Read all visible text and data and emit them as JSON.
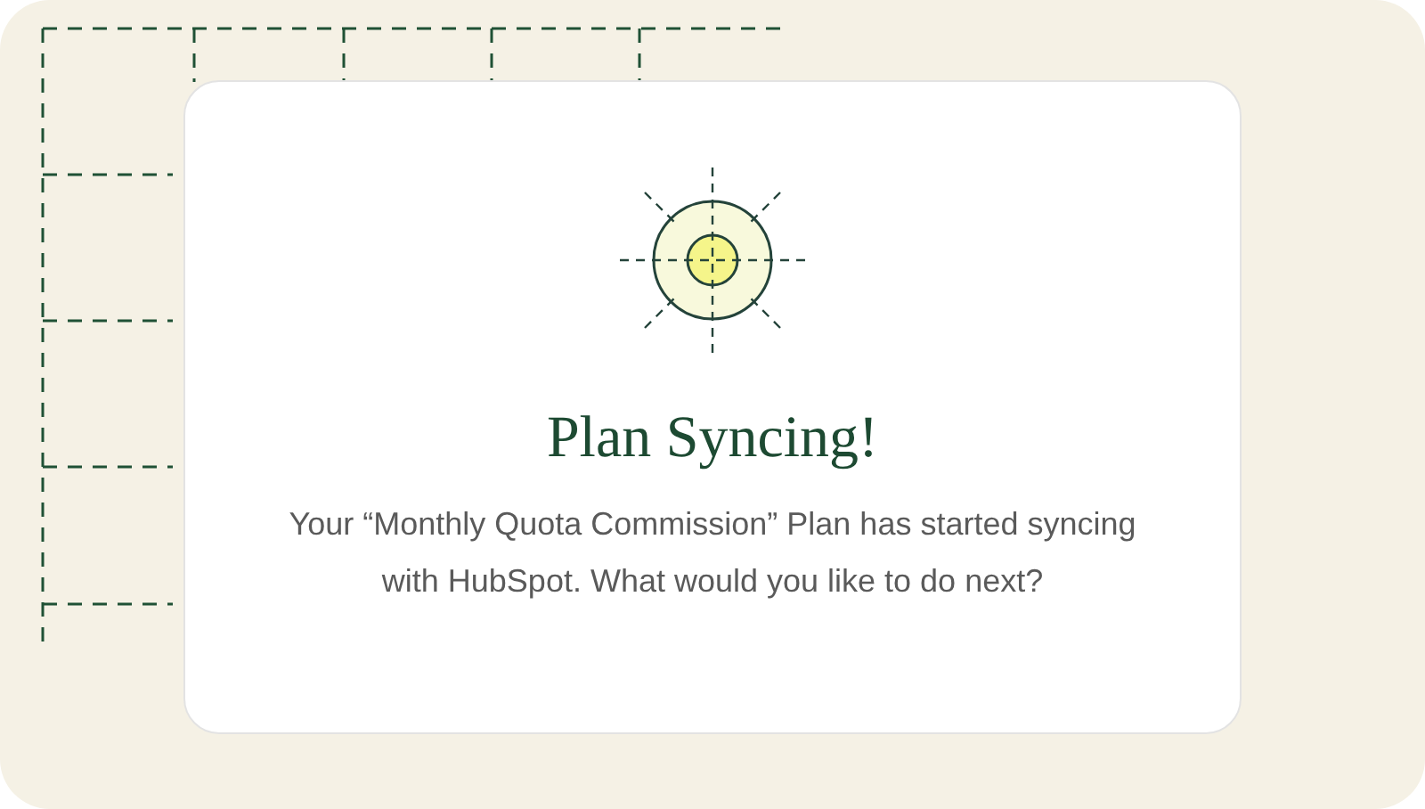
{
  "dialog": {
    "title": "Plan Syncing!",
    "message": "Your “Monthly Quota Commission” Plan has started syncing with HubSpot. What would you like to do next?"
  }
}
